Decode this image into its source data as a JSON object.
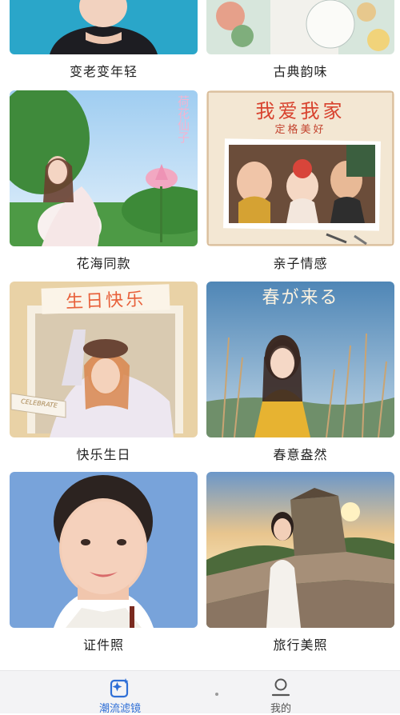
{
  "cards": [
    {
      "label": "变老变年轻"
    },
    {
      "label": "古典韵味"
    },
    {
      "label": "花海同款",
      "overlay_text": "荷花仙子"
    },
    {
      "label": "亲子情感",
      "overlay_title": "我爱我家",
      "overlay_sub": "定格美好"
    },
    {
      "label": "快乐生日",
      "overlay_title": "生日快乐",
      "overlay_sub": "CELEBRATE"
    },
    {
      "label": "春意盎然",
      "overlay_title": "春が来る"
    },
    {
      "label": "证件照"
    },
    {
      "label": "旅行美照"
    }
  ],
  "tabbar": {
    "tabs": [
      {
        "label": "潮流滤镜",
        "icon": "sparkle-square-icon",
        "active": true
      },
      {
        "label": "我的",
        "icon": "person-icon",
        "active": false
      }
    ]
  },
  "colors": {
    "accent": "#2f6fd6",
    "inactive": "#555555"
  }
}
